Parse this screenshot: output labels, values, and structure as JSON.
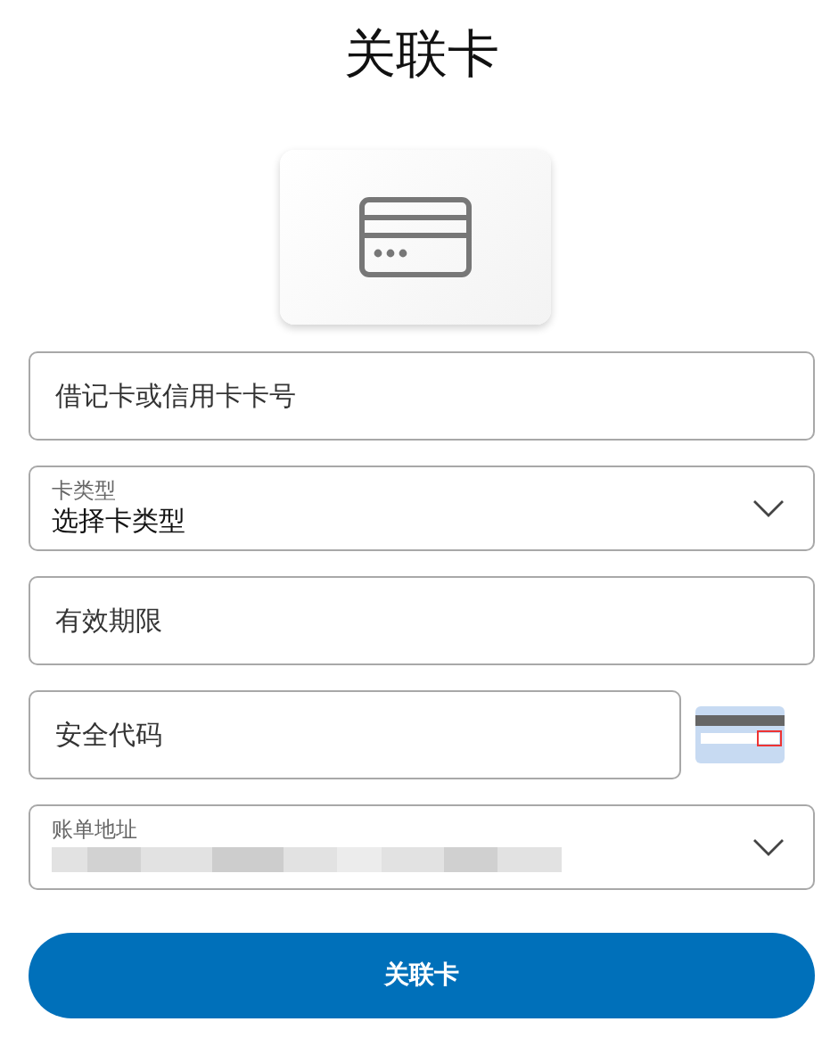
{
  "title": "关联卡",
  "fields": [
    {
      "kind": "text",
      "placeholder": "借记卡或信用卡卡号"
    },
    {
      "kind": "select",
      "label": "卡类型",
      "value": "选择卡类型"
    },
    {
      "kind": "text",
      "placeholder": "有效期限"
    },
    {
      "kind": "cvv",
      "placeholder": "安全代码"
    },
    {
      "kind": "select-redacted",
      "label": "账单地址"
    }
  ],
  "submit": "关联卡"
}
